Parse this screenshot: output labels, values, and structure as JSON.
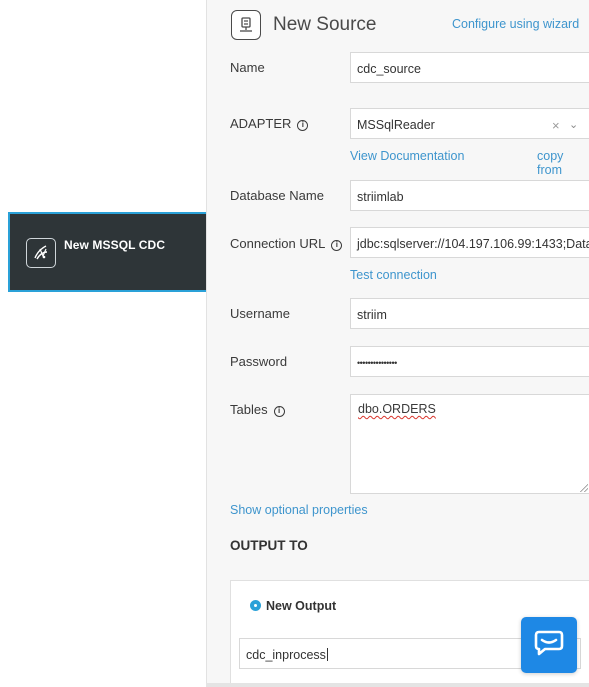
{
  "canvas": {
    "node": {
      "label": "New MSSQL CDC",
      "icon": "database-icon",
      "border_color": "#2aa1d8",
      "background": "#2e3538"
    }
  },
  "panel": {
    "title": "New Source",
    "header_icon": "source-icon",
    "wizard_link": "Configure using wizard",
    "fields": {
      "name": {
        "label": "Name",
        "value": "cdc_source"
      },
      "adapter": {
        "label": "ADAPTER",
        "value": "MSSqlReader",
        "clear": "×",
        "caret": "⌄",
        "info": "i"
      },
      "database_name": {
        "label": "Database Name",
        "value": "striimlab"
      },
      "connection_url": {
        "label": "Connection URL",
        "value": "jdbc:sqlserver://104.197.106.99:1433;Data",
        "info": "i"
      },
      "username": {
        "label": "Username",
        "value": "striim"
      },
      "password": {
        "label": "Password",
        "value": "•••••••••••••••"
      },
      "tables": {
        "label": "Tables",
        "value": "dbo.ORDERS",
        "info": "i"
      }
    },
    "links": {
      "view_documentation": "View Documentation",
      "copy_from": "copy from",
      "test_connection": "Test connection",
      "show_optional": "Show optional properties"
    },
    "output": {
      "section_title": "OUTPUT TO",
      "option_label": "New Output",
      "value": "cdc_inprocess"
    }
  },
  "chat": {
    "icon": "chat-bubble-icon",
    "color": "#1e88e5"
  },
  "accent_color": "#3e95cd"
}
